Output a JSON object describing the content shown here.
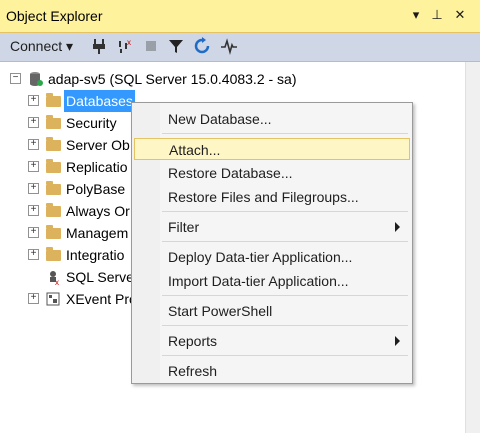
{
  "window": {
    "title": "Object Explorer",
    "controls": [
      "▼",
      "📌",
      "✕"
    ]
  },
  "toolbar": {
    "connect_label": "Connect ▾"
  },
  "tree": {
    "root": "adap-sv5 (SQL Server 15.0.4083.2 - sa)",
    "items": [
      {
        "label": "Databases",
        "selected": true
      },
      {
        "label": "Security"
      },
      {
        "label": "Server Ob"
      },
      {
        "label": "Replicatio"
      },
      {
        "label": "PolyBase"
      },
      {
        "label": "Always Or"
      },
      {
        "label": "Managem"
      },
      {
        "label": "Integratio"
      },
      {
        "label": "SQL Serve"
      },
      {
        "label": "XEvent Pro"
      }
    ]
  },
  "context_menu": {
    "items": [
      {
        "label": "New Database..."
      },
      {
        "label": "Attach...",
        "highlighted": true
      },
      {
        "label": "Restore Database..."
      },
      {
        "label": "Restore Files and Filegroups..."
      },
      {
        "label": "Filter",
        "submenu": true
      },
      {
        "label": "Deploy Data-tier Application..."
      },
      {
        "label": "Import Data-tier Application..."
      },
      {
        "label": "Start PowerShell"
      },
      {
        "label": "Reports",
        "submenu": true
      },
      {
        "label": "Refresh"
      }
    ]
  },
  "colors": {
    "titlebar": "#fff29d",
    "toolbar": "#cfd6e5",
    "selection": "#3399ff",
    "menu_highlight": "#fff6c5"
  }
}
